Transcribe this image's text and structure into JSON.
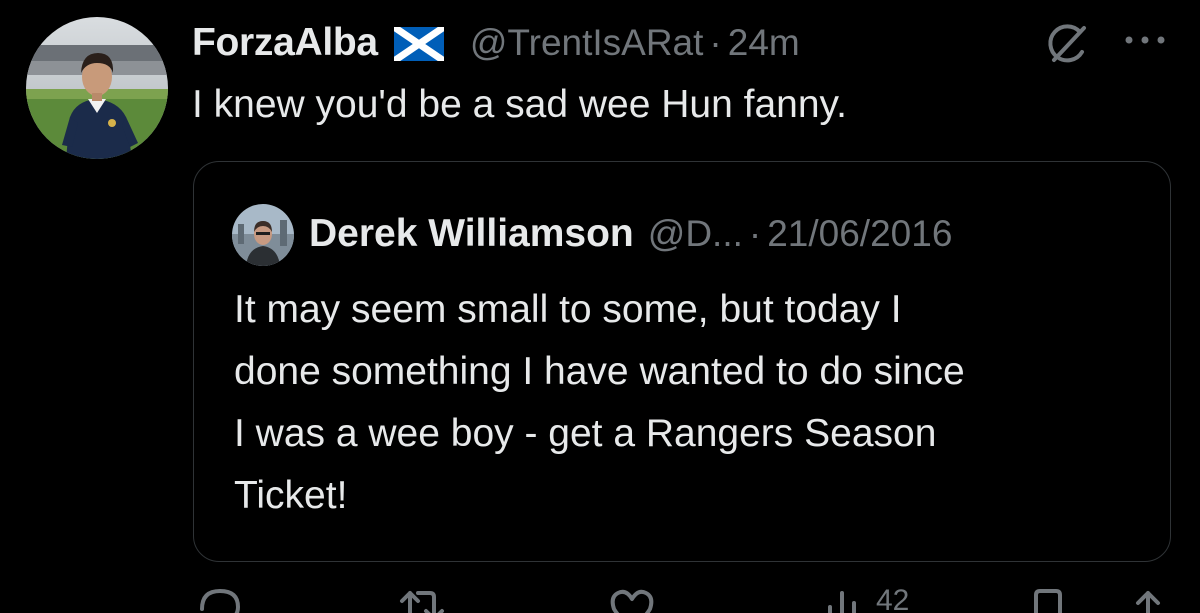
{
  "tweet": {
    "author": {
      "display_name": "ForzaAlba",
      "flag_icon": "scotland-flag-icon",
      "handle": "@TrentIsARat",
      "separator": "·",
      "time": "24m"
    },
    "text": "I knew you'd be a sad wee Hun fanny.",
    "quoted": {
      "display_name": "Derek Williamson",
      "handle": "@D...",
      "separator": "·",
      "date": "21/06/2016",
      "text": "It may seem small to some, but today I\ndone something I have wanted to do since\nI was a wee boy - get a Rangers Season\nTicket!"
    },
    "actions": {
      "views_count": "42"
    }
  },
  "colors": {
    "background": "#000000",
    "primary_text": "#e7e9ea",
    "secondary_text": "#71767b",
    "border": "#2f3336",
    "flag_blue": "#005eb8"
  }
}
